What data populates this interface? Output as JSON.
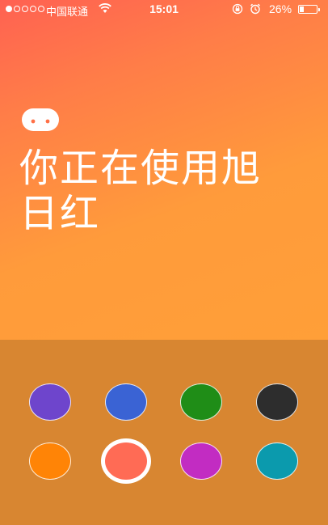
{
  "status_bar": {
    "carrier": "中国联通",
    "time": "15:01",
    "battery_percent": "26%",
    "battery_level": 0.26,
    "signal_dots_filled": 1,
    "signal_dots_total": 5,
    "icons": [
      "wifi-icon",
      "rotation-lock-icon",
      "alarm-icon",
      "battery-icon"
    ]
  },
  "header": {
    "mascot_icon": "mascot-face-icon",
    "title_line1": "你正在使用旭",
    "title_line2": "日红"
  },
  "theme": {
    "active_gradient": [
      "#ff6152",
      "#ff9f38"
    ],
    "panel_color": "#d88631"
  },
  "palette": {
    "selected_index": 5,
    "swatches": [
      {
        "name": "purple",
        "color": "#6e45cc"
      },
      {
        "name": "blue",
        "color": "#3a63d4"
      },
      {
        "name": "green",
        "color": "#1f8d17"
      },
      {
        "name": "black",
        "color": "#2d2d2d"
      },
      {
        "name": "orange",
        "color": "#ff8406"
      },
      {
        "name": "sunrise-red",
        "color": "#ff6b55"
      },
      {
        "name": "magenta",
        "color": "#c22cc2"
      },
      {
        "name": "teal",
        "color": "#0b9aad"
      }
    ]
  }
}
